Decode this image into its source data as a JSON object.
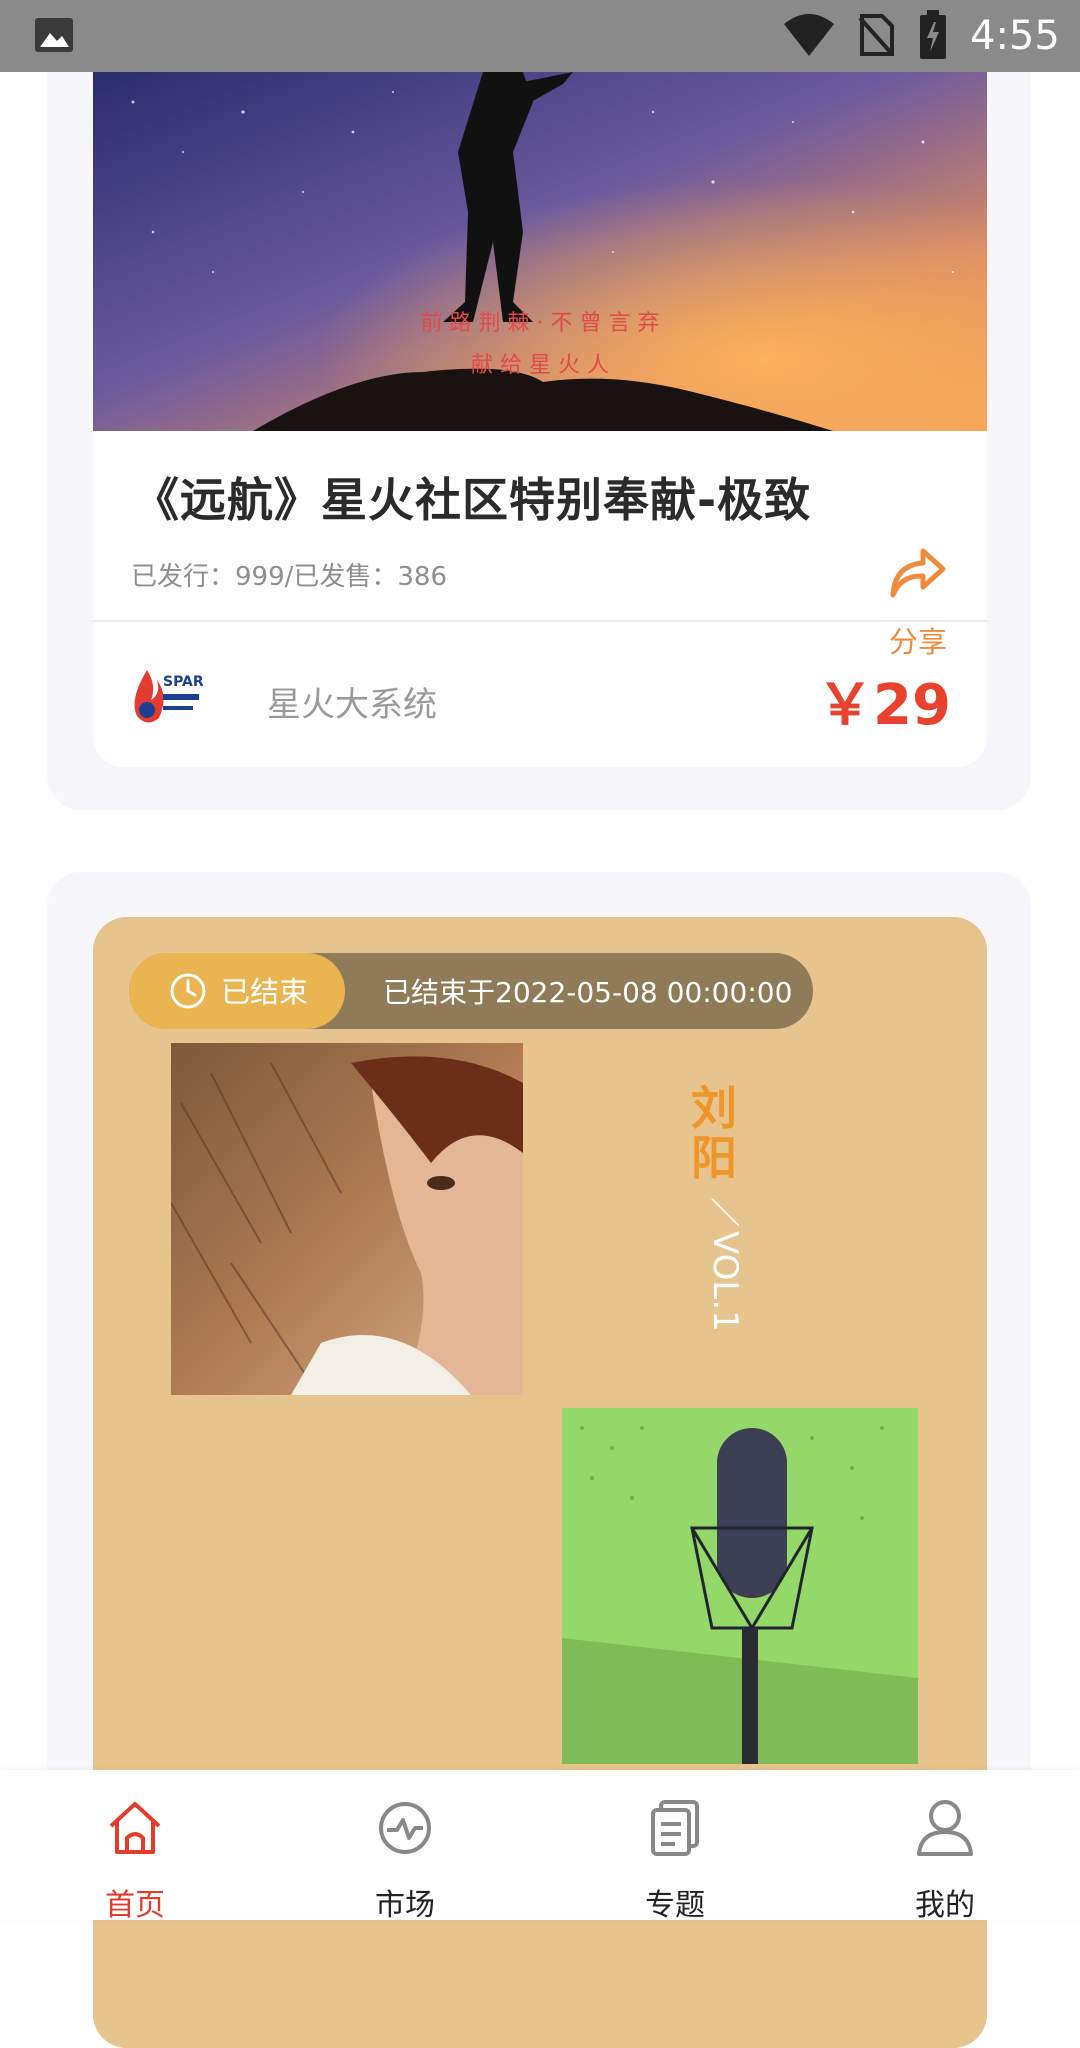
{
  "status_bar": {
    "time": "4:55"
  },
  "card1": {
    "poster": {
      "line1": "前 路 荆 棘 · 不 曾 言 弃",
      "line2": "献 给 星 火 人"
    },
    "title": "《远航》星火社区特别奉献-极致",
    "meta": "已发行：999/已发售：386",
    "share_label": "分享",
    "creator_name": "星火大系统",
    "creator_logo_text": "SPARK",
    "price": "￥29"
  },
  "card2": {
    "status_label": "已结束",
    "end_time": "已结束于2022-05-08 00:00:00",
    "album_name": "刘阳",
    "album_vol": "／VOL.1"
  },
  "tabs": [
    {
      "label": "首页",
      "icon": "home-icon",
      "active": true
    },
    {
      "label": "市场",
      "icon": "market-icon",
      "active": false
    },
    {
      "label": "专题",
      "icon": "topic-icon",
      "active": false
    },
    {
      "label": "我的",
      "icon": "profile-icon",
      "active": false
    }
  ],
  "colors": {
    "accent": "#e63a2b",
    "price": "#e8422f",
    "share": "#f08a3c",
    "ended_badge": "#eab551",
    "album_bg": "#e7c48d"
  }
}
